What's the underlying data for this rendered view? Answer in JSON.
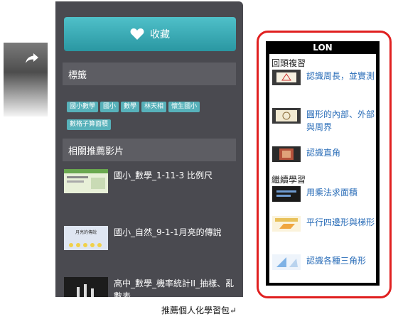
{
  "favorite": {
    "label": "收藏"
  },
  "tags_section": {
    "heading": "標籤",
    "tags": [
      "國小數學",
      "國小",
      "數學",
      "林天相",
      "懷生國小",
      "數格子算面積"
    ]
  },
  "related_section": {
    "heading": "相關推薦影片",
    "items": [
      {
        "title": "國小_數學_1-11-3 比例尺"
      },
      {
        "title": "國小_自然_9-1-1月亮的傳說",
        "thumb_caption": "月亮的傳說"
      },
      {
        "title": "高中_數學_機率統計II_抽樣、亂數表"
      }
    ]
  },
  "package": {
    "title": "LON",
    "review_heading": "回頭複習",
    "review_items": [
      {
        "label": "認識周長，並實測"
      },
      {
        "label": "圓形的內部、外部與周界"
      },
      {
        "label": "認識直角"
      }
    ],
    "continue_heading": "繼續學習",
    "continue_items": [
      {
        "label": "用乘法求面積"
      },
      {
        "label": "平行四邊形與梯形"
      },
      {
        "label": "認識各種三角形"
      }
    ]
  },
  "caption": "推薦個人化學習包↵",
  "colors": {
    "panel": "#4a4a50",
    "accent": "#2aa6b0",
    "tag": "#57b1ba",
    "link": "#2a6db8",
    "frame": "#e02020"
  },
  "icons": {
    "share": "share-arrow-icon",
    "favorite": "heart-icon"
  }
}
